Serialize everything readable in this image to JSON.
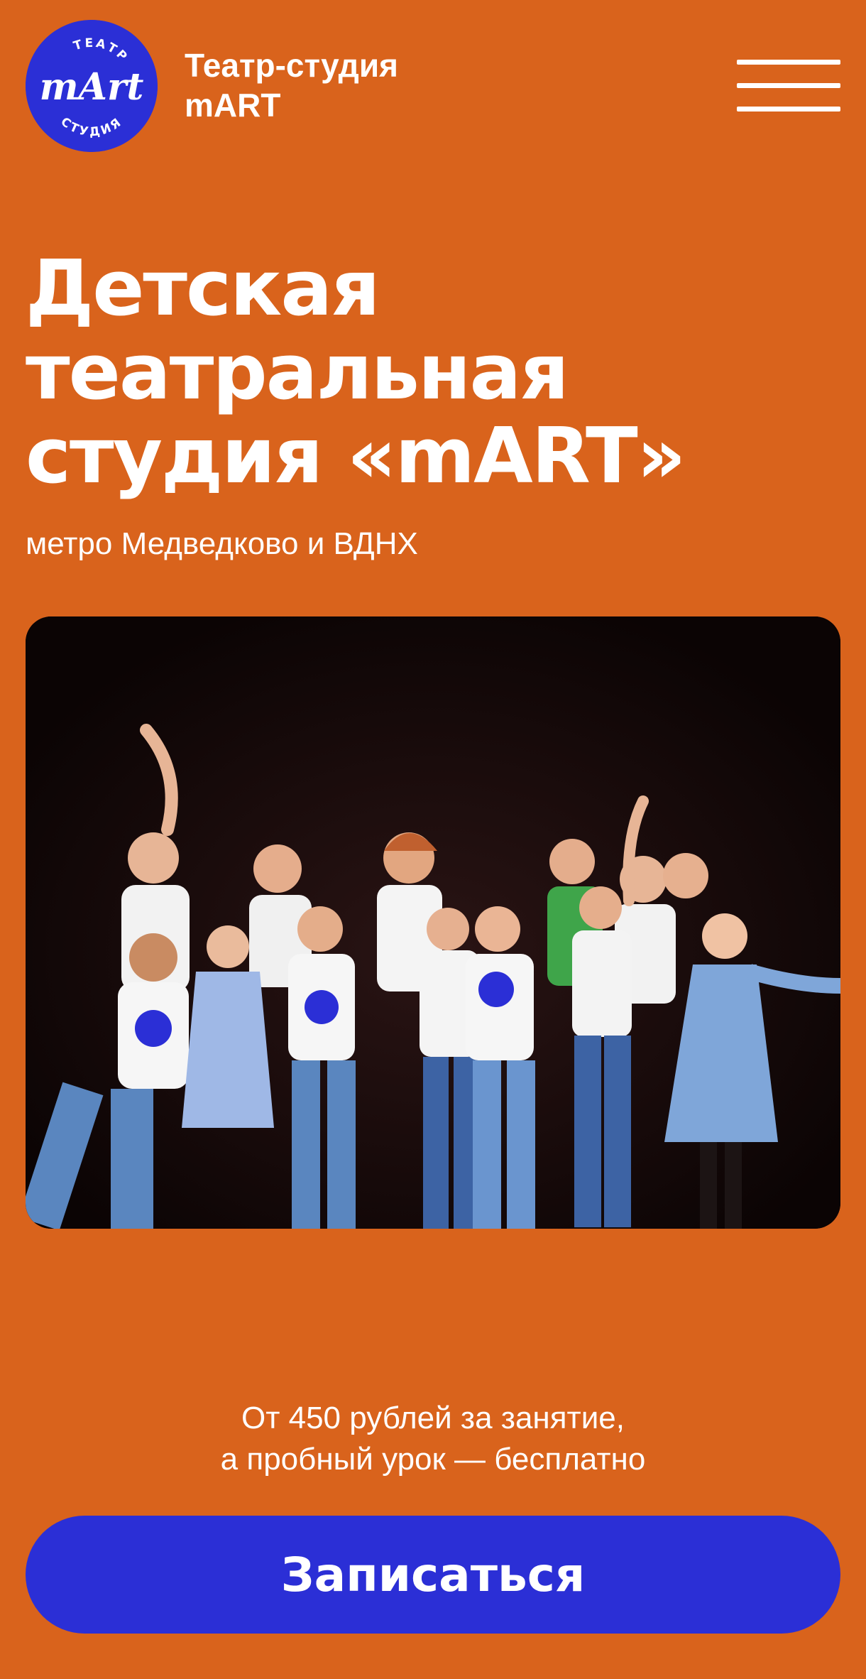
{
  "header": {
    "logo": {
      "top_text": "ТЕАТР",
      "bottom_text": "СТУДИЯ",
      "mark_text": "mArt"
    },
    "brand_line1": "Театр-студия",
    "brand_line2": "mART",
    "menu_icon": "hamburger-menu-icon"
  },
  "hero": {
    "title_line1": "Детская",
    "title_line2": "театральная",
    "title_line3": "студия «mART»",
    "subtitle": "метро Медведково и ВДНХ"
  },
  "photo": {
    "content": "group-of-children-on-stage-image"
  },
  "offer": {
    "line1": "От 450 рублей за занятие,",
    "line2": "а пробный урок — бесплатно"
  },
  "cta": {
    "label": "Записаться"
  },
  "colors": {
    "background": "#D9631C",
    "accent": "#2B2FD6",
    "text": "#FFFFFF"
  }
}
